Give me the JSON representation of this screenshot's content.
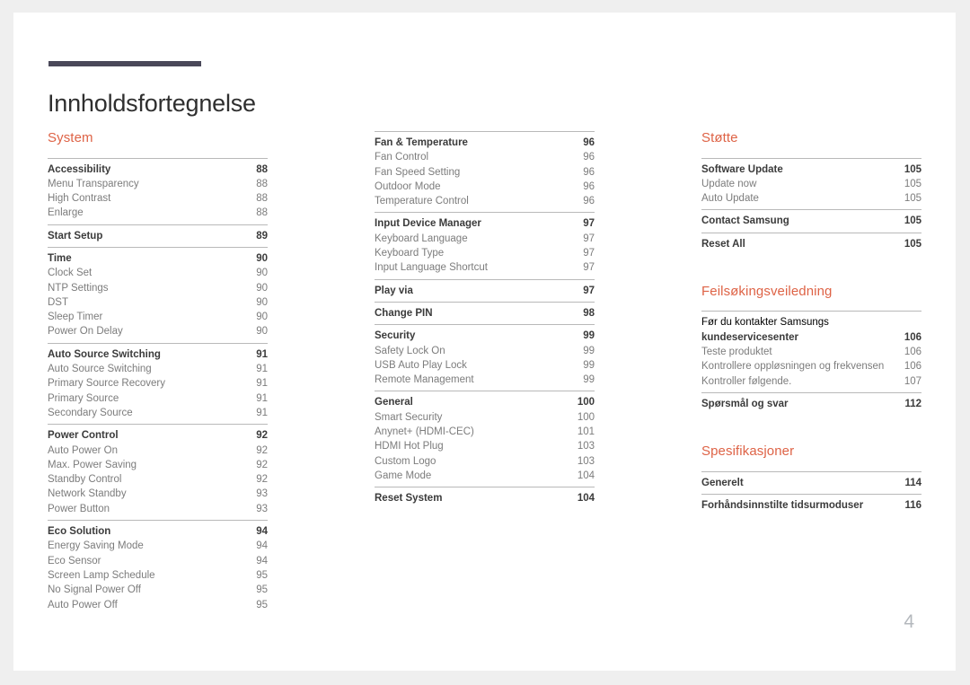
{
  "document": {
    "title": "Innholdsfortegnelse",
    "folio": "4",
    "accent_color": "#de6346",
    "rule_color": "#4a4859"
  },
  "columns": [
    {
      "id": "column-1",
      "heading": "System",
      "groups": [
        {
          "rows": [
            {
              "label": "Accessibility",
              "page": "88",
              "level": "head"
            },
            {
              "label": "Menu Transparency",
              "page": "88",
              "level": "sub"
            },
            {
              "label": "High Contrast",
              "page": "88",
              "level": "sub"
            },
            {
              "label": "Enlarge",
              "page": "88",
              "level": "sub"
            }
          ]
        },
        {
          "rows": [
            {
              "label": "Start Setup",
              "page": "89",
              "level": "head"
            }
          ]
        },
        {
          "rows": [
            {
              "label": "Time",
              "page": "90",
              "level": "head"
            },
            {
              "label": "Clock Set",
              "page": "90",
              "level": "sub"
            },
            {
              "label": "NTP Settings",
              "page": "90",
              "level": "sub"
            },
            {
              "label": "DST",
              "page": "90",
              "level": "sub"
            },
            {
              "label": "Sleep Timer",
              "page": "90",
              "level": "sub"
            },
            {
              "label": "Power On Delay",
              "page": "90",
              "level": "sub"
            }
          ]
        },
        {
          "rows": [
            {
              "label": "Auto Source Switching",
              "page": "91",
              "level": "head"
            },
            {
              "label": "Auto Source Switching",
              "page": "91",
              "level": "sub"
            },
            {
              "label": "Primary Source Recovery",
              "page": "91",
              "level": "sub"
            },
            {
              "label": "Primary Source",
              "page": "91",
              "level": "sub"
            },
            {
              "label": "Secondary Source",
              "page": "91",
              "level": "sub"
            }
          ]
        },
        {
          "rows": [
            {
              "label": "Power Control",
              "page": "92",
              "level": "head"
            },
            {
              "label": "Auto Power On",
              "page": "92",
              "level": "sub"
            },
            {
              "label": "Max. Power Saving",
              "page": "92",
              "level": "sub"
            },
            {
              "label": "Standby Control",
              "page": "92",
              "level": "sub"
            },
            {
              "label": "Network Standby",
              "page": "93",
              "level": "sub"
            },
            {
              "label": "Power Button",
              "page": "93",
              "level": "sub"
            }
          ]
        },
        {
          "rows": [
            {
              "label": "Eco Solution",
              "page": "94",
              "level": "head"
            },
            {
              "label": "Energy Saving Mode",
              "page": "94",
              "level": "sub"
            },
            {
              "label": "Eco Sensor",
              "page": "94",
              "level": "sub"
            },
            {
              "label": "Screen Lamp Schedule",
              "page": "95",
              "level": "sub"
            },
            {
              "label": "No Signal Power Off",
              "page": "95",
              "level": "sub"
            },
            {
              "label": "Auto Power Off",
              "page": "95",
              "level": "sub"
            }
          ]
        }
      ]
    },
    {
      "id": "column-2",
      "heading": "",
      "groups": [
        {
          "rows": [
            {
              "label": "Fan & Temperature",
              "page": "96",
              "level": "head"
            },
            {
              "label": "Fan Control",
              "page": "96",
              "level": "sub"
            },
            {
              "label": "Fan Speed Setting",
              "page": "96",
              "level": "sub"
            },
            {
              "label": "Outdoor Mode",
              "page": "96",
              "level": "sub"
            },
            {
              "label": "Temperature Control",
              "page": "96",
              "level": "sub"
            }
          ]
        },
        {
          "rows": [
            {
              "label": "Input Device Manager",
              "page": "97",
              "level": "head"
            },
            {
              "label": "Keyboard Language",
              "page": "97",
              "level": "sub"
            },
            {
              "label": "Keyboard Type",
              "page": "97",
              "level": "sub"
            },
            {
              "label": "Input Language Shortcut",
              "page": "97",
              "level": "sub"
            }
          ]
        },
        {
          "rows": [
            {
              "label": "Play via",
              "page": "97",
              "level": "head"
            }
          ]
        },
        {
          "rows": [
            {
              "label": "Change PIN",
              "page": "98",
              "level": "head"
            }
          ]
        },
        {
          "rows": [
            {
              "label": "Security",
              "page": "99",
              "level": "head"
            },
            {
              "label": "Safety Lock On",
              "page": "99",
              "level": "sub"
            },
            {
              "label": "USB Auto Play Lock",
              "page": "99",
              "level": "sub"
            },
            {
              "label": "Remote Management",
              "page": "99",
              "level": "sub"
            }
          ]
        },
        {
          "rows": [
            {
              "label": "General",
              "page": "100",
              "level": "head"
            },
            {
              "label": "Smart Security",
              "page": "100",
              "level": "sub"
            },
            {
              "label": "Anynet+ (HDMI-CEC)",
              "page": "101",
              "level": "sub"
            },
            {
              "label": "HDMI Hot Plug",
              "page": "103",
              "level": "sub"
            },
            {
              "label": "Custom Logo",
              "page": "103",
              "level": "sub"
            },
            {
              "label": "Game Mode",
              "page": "104",
              "level": "sub"
            }
          ]
        },
        {
          "rows": [
            {
              "label": "Reset System",
              "page": "104",
              "level": "head"
            }
          ]
        }
      ]
    },
    {
      "id": "column-3",
      "heading": "Støtte",
      "groups": [
        {
          "rows": [
            {
              "label": "Software Update",
              "page": "105",
              "level": "head"
            },
            {
              "label": "Update now",
              "page": "105",
              "level": "sub"
            },
            {
              "label": "Auto Update",
              "page": "105",
              "level": "sub"
            }
          ]
        },
        {
          "rows": [
            {
              "label": "Contact Samsung",
              "page": "105",
              "level": "head"
            }
          ]
        },
        {
          "rows": [
            {
              "label": "Reset All",
              "page": "105",
              "level": "head"
            }
          ]
        }
      ],
      "sections": [
        {
          "heading": "Feilsøkingsveiledning",
          "groups": [
            {
              "rows": [
                {
                  "label": "Før du kontakter Samsungs kundeservicesenter",
                  "label_line_1": "Før du kontakter Samsungs",
                  "label_line_2": "kundeservicesenter",
                  "page": "106",
                  "level": "head",
                  "wrapped": true
                },
                {
                  "label": "Teste produktet",
                  "page": "106",
                  "level": "sub"
                },
                {
                  "label": "Kontrollere oppløsningen og frekvensen",
                  "page": "106",
                  "level": "sub"
                },
                {
                  "label": "Kontroller følgende.",
                  "page": "107",
                  "level": "sub"
                }
              ]
            },
            {
              "rows": [
                {
                  "label": "Spørsmål og svar",
                  "page": "112",
                  "level": "head"
                }
              ]
            }
          ]
        },
        {
          "heading": "Spesifikasjoner",
          "groups": [
            {
              "rows": [
                {
                  "label": "Generelt",
                  "page": "114",
                  "level": "head"
                }
              ]
            },
            {
              "rows": [
                {
                  "label": "Forhåndsinnstilte tidsurmoduser",
                  "page": "116",
                  "level": "head"
                }
              ]
            }
          ]
        }
      ]
    }
  ]
}
